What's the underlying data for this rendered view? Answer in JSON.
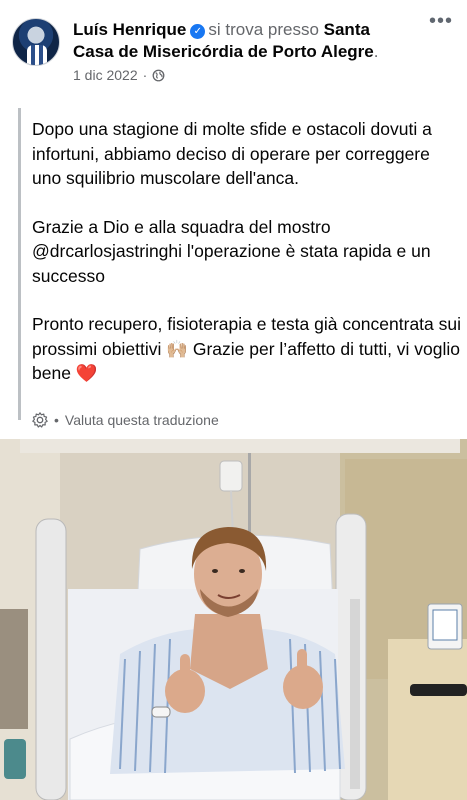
{
  "post": {
    "author": "Luís Henrique",
    "checkin_prefix": "si trova presso",
    "place": "Santa Casa de Misericórdia de Porto Alegre",
    "place_end": ".",
    "date": "1 dic 2022",
    "meta_separator": "·",
    "privacy_icon": "globe-icon",
    "more_icon": "more-options-icon",
    "more_label": "•••",
    "verified_icon": "verified-badge-icon",
    "paragraphs": [
      "Dopo una stagione di molte sfide e ostacoli dovuti a infortuni, abbiamo deciso di operare per correggere uno squilibrio muscolare dell'anca.",
      "Grazie a Dio e alla squadra del mostro @drcarlosjastringhi l'operazione è stata rapida e un successo",
      "Pronto recupero, fisioterapia e testa già concentrata sui prossimi obiettivi 🙌🏼 Grazie per l’affetto di tutti, vi voglio bene"
    ],
    "heart_emoji": "❤️"
  },
  "translation": {
    "separator": "•",
    "label": "Valuta questa traduzione",
    "icon": "gear-icon"
  },
  "colors": {
    "verified": "#1877f2",
    "secondary_text": "#65676b",
    "quote_bar": "#bcc0c4"
  }
}
